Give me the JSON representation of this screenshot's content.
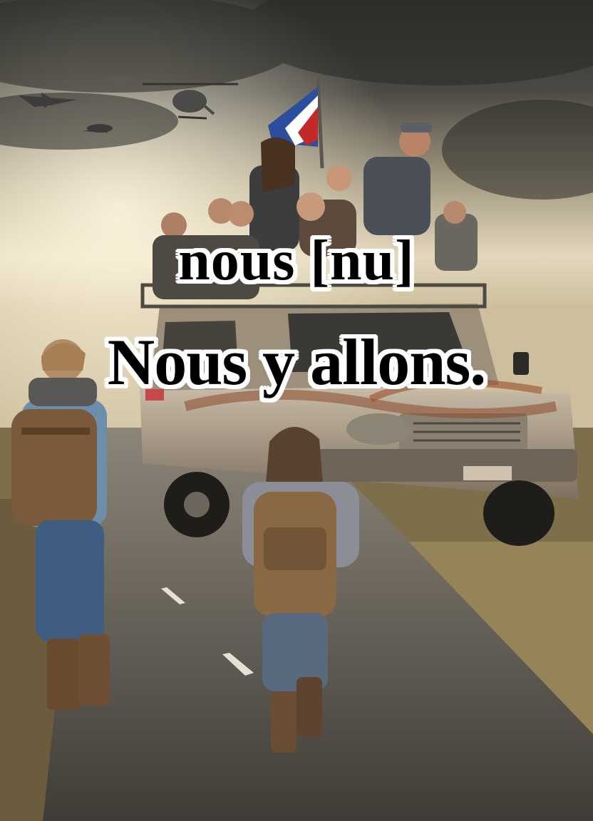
{
  "caption": {
    "word": "nous [nu]",
    "sentence": "Nous y allons."
  },
  "license_plate": "",
  "colors": {
    "sky_dark": "#3a3a36",
    "sky_light": "#e9dfc6",
    "road": "#55524c",
    "grass": "#8a7a50",
    "vehicle_body": "#b9ab98",
    "rust": "#8b4a2a",
    "flag_blue": "#2b4f9a",
    "flag_red": "#c22a2a",
    "caption_text": "#000000",
    "caption_outline": "#ffffff"
  }
}
